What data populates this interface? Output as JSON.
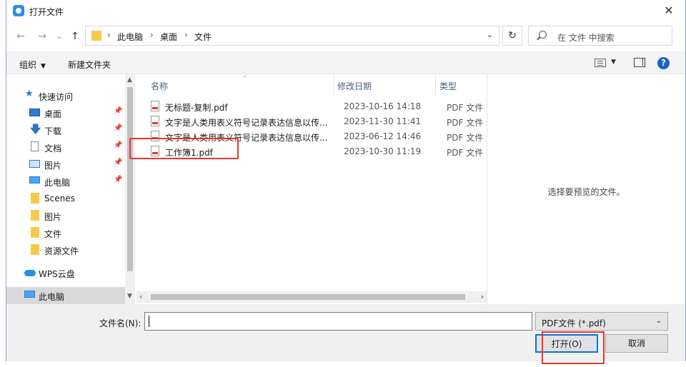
{
  "window": {
    "title": "打开文件",
    "close_glyph": "✕"
  },
  "nav_buttons": {
    "back": "←",
    "forward": "→",
    "recent": "⌄",
    "up": "↑"
  },
  "address": {
    "crumbs": [
      "此电脑",
      "桌面",
      "文件"
    ],
    "separator": "›",
    "dropdown": "⌄"
  },
  "refresh_glyph": "↻",
  "search": {
    "placeholder": "在 文件 中搜索"
  },
  "toolbar": {
    "organize": "组织",
    "new_folder": "新建文件夹",
    "help": "?"
  },
  "nav_pane": {
    "items": [
      {
        "label": "快速访问",
        "icon": "star-icon"
      },
      {
        "label": "桌面",
        "icon": "desktop-icon",
        "pinned": true
      },
      {
        "label": "下载",
        "icon": "download-icon",
        "pinned": true
      },
      {
        "label": "文档",
        "icon": "document-icon",
        "pinned": true
      },
      {
        "label": "图片",
        "icon": "pictures-icon",
        "pinned": true
      },
      {
        "label": "此电脑",
        "icon": "computer-icon",
        "pinned": true
      },
      {
        "label": "Scenes",
        "icon": "folder-icon"
      },
      {
        "label": "图片",
        "icon": "folder-icon"
      },
      {
        "label": "文件",
        "icon": "folder-icon"
      },
      {
        "label": "资源文件",
        "icon": "folder-icon"
      },
      {
        "label": "WPS云盘",
        "icon": "cloud-icon"
      },
      {
        "label": "此电脑",
        "icon": "computer-icon",
        "selected": true
      }
    ]
  },
  "file_list": {
    "columns": {
      "name": "名称",
      "modified": "修改日期",
      "type": "类型"
    },
    "rows": [
      {
        "name": "无标题-复制.pdf",
        "modified": "2023-10-16 14:18",
        "type": "PDF 文件"
      },
      {
        "name": "文字是人类用表义符号记录表达信息以传...",
        "modified": "2023-11-30 11:41",
        "type": "PDF 文件"
      },
      {
        "name": "文字是人类用表义符号记录表达信息以传...",
        "modified": "2023-06-12 14:46",
        "type": "PDF 文件"
      },
      {
        "name": "工作簿1.pdf",
        "modified": "2023-10-30 11:19",
        "type": "PDF 文件"
      }
    ]
  },
  "preview": {
    "empty_text": "选择要预览的文件。"
  },
  "bottom": {
    "filename_label": "文件名(N):",
    "filename_value": "",
    "filter": "PDF文件 (*.pdf)",
    "open": "打开(O)",
    "cancel": "取消"
  },
  "colors": {
    "accent": "#0078d7",
    "highlight": "#e33333",
    "folder": "#f7c94b"
  }
}
